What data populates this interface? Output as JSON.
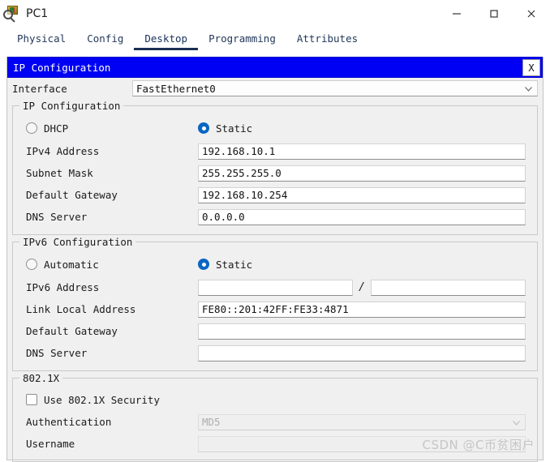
{
  "window": {
    "title": "PC1",
    "icon": "pc-magnifier-icon",
    "controls": {
      "minimize": "minimize-icon",
      "maximize": "maximize-icon",
      "close": "close-icon"
    }
  },
  "tabs": [
    {
      "label": "Physical",
      "active": false
    },
    {
      "label": "Config",
      "active": false
    },
    {
      "label": "Desktop",
      "active": true
    },
    {
      "label": "Programming",
      "active": false
    },
    {
      "label": "Attributes",
      "active": false
    }
  ],
  "dialog": {
    "title": "IP Configuration",
    "close_label": "X"
  },
  "interface": {
    "label": "Interface",
    "value": "FastEthernet0"
  },
  "ipv4": {
    "group_title": "IP Configuration",
    "mode": {
      "dhcp_label": "DHCP",
      "dhcp_selected": false,
      "static_label": "Static",
      "static_selected": true
    },
    "fields": [
      {
        "label": "IPv4 Address",
        "value": "192.168.10.1"
      },
      {
        "label": "Subnet Mask",
        "value": "255.255.255.0"
      },
      {
        "label": "Default Gateway",
        "value": "192.168.10.254"
      },
      {
        "label": "DNS Server",
        "value": "0.0.0.0"
      }
    ]
  },
  "ipv6": {
    "group_title": "IPv6 Configuration",
    "mode": {
      "auto_label": "Automatic",
      "auto_selected": false,
      "static_label": "Static",
      "static_selected": true
    },
    "address": {
      "label": "IPv6 Address",
      "value": "",
      "separator": "/",
      "prefix": ""
    },
    "fields": [
      {
        "label": "Link Local Address",
        "value": "FE80::201:42FF:FE33:4871"
      },
      {
        "label": "Default Gateway",
        "value": ""
      },
      {
        "label": "DNS Server",
        "value": ""
      }
    ]
  },
  "dot1x": {
    "group_title": "802.1X",
    "use_label": "Use 802.1X Security",
    "use_checked": false,
    "auth_label": "Authentication",
    "auth_value": "MD5",
    "username_label": "Username",
    "username_value": ""
  },
  "watermark": "CSDN @C币贫困户",
  "colors": {
    "dialog_bar": "#0000f5",
    "accent_radio": "#0a66c2",
    "panel_bg": "#f0f0f0",
    "tab_active": "#1b2f55"
  }
}
